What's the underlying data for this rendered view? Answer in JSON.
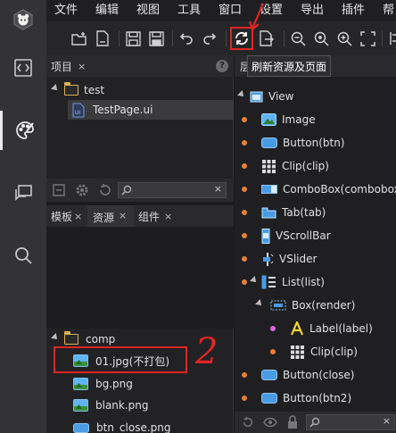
{
  "menu": [
    "文件",
    "编辑",
    "视图",
    "工具",
    "窗口",
    "设置",
    "导出",
    "插件",
    "帮"
  ],
  "tooltip": "刷新资源及页面",
  "annotation": "2",
  "project_panel": {
    "tab": "项目",
    "close": "×",
    "help": "?",
    "tree": [
      {
        "label": "test",
        "type": "folder"
      },
      {
        "label": "TestPage.ui",
        "type": "ui-file"
      }
    ]
  },
  "asset_panel": {
    "tabs": [
      {
        "label": "模板",
        "close": "×"
      },
      {
        "label": "资源",
        "close": "×"
      },
      {
        "label": "组件",
        "close": "×"
      }
    ],
    "search_clear": "×",
    "tree": [
      {
        "label": "comp",
        "type": "folder"
      },
      {
        "label": "01.jpg(不打包)",
        "type": "image"
      },
      {
        "label": "bg.png",
        "type": "image"
      },
      {
        "label": "blank.png",
        "type": "image"
      },
      {
        "label": "btn_close.png",
        "type": "button"
      }
    ]
  },
  "hierarchy_panel": {
    "tab_partial": "层",
    "root": "View",
    "nodes": [
      {
        "label": "Image",
        "icon": "image-icon",
        "dot": "#e6803a"
      },
      {
        "label": "Button(btn)",
        "icon": "button-icon",
        "dot": "#e6803a"
      },
      {
        "label": "Clip(clip)",
        "icon": "clip-icon",
        "dot": "#e6803a"
      },
      {
        "label": "ComboBox(combobox)",
        "icon": "combobox-icon",
        "dot": "#e6803a"
      },
      {
        "label": "Tab(tab)",
        "icon": "tab-icon",
        "dot": "#e6803a"
      },
      {
        "label": "VScrollBar",
        "icon": "vscrollbar-icon",
        "dot": "#e6803a"
      },
      {
        "label": "VSlider",
        "icon": "vslider-icon",
        "dot": "#e6803a"
      },
      {
        "label": "List(list)",
        "icon": "list-icon",
        "dot": "#e6803a"
      },
      {
        "label": "Box(render)",
        "icon": "box-icon",
        "dot": ""
      },
      {
        "label": "Label(label)",
        "icon": "label-icon",
        "dot": "#d86ad8"
      },
      {
        "label": "Clip(clip)",
        "icon": "clip-icon",
        "dot": "#e6803a"
      },
      {
        "label": "Button(close)",
        "icon": "button-icon",
        "dot": "#e6803a"
      },
      {
        "label": "Button(btn2)",
        "icon": "button-icon",
        "dot": "#e6803a"
      }
    ],
    "search_clear": "×"
  },
  "colors": {
    "annotation_red": "#e02525",
    "accent_blue": "#4a9be2",
    "folder": "#d9b25a"
  }
}
